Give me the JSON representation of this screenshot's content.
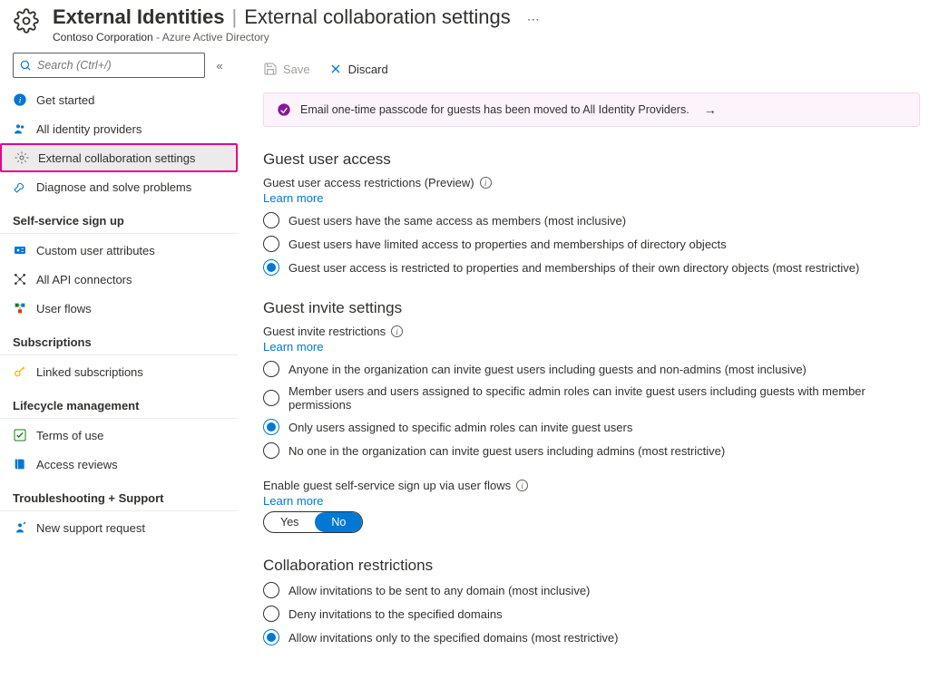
{
  "header": {
    "title_main": "External Identities",
    "title_sub": "External collaboration settings",
    "org": "Contoso Corporation",
    "service": "Azure Active Directory"
  },
  "sidebar": {
    "search_placeholder": "Search (Ctrl+/)",
    "items_top": [
      {
        "icon": "info",
        "label": "Get started"
      },
      {
        "icon": "people",
        "label": "All identity providers"
      },
      {
        "icon": "gear",
        "label": "External collaboration settings",
        "active": true
      },
      {
        "icon": "wrench",
        "label": "Diagnose and solve problems"
      }
    ],
    "sections": [
      {
        "title": "Self-service sign up",
        "items": [
          {
            "icon": "id",
            "label": "Custom user attributes"
          },
          {
            "icon": "api",
            "label": "All API connectors"
          },
          {
            "icon": "flow",
            "label": "User flows"
          }
        ]
      },
      {
        "title": "Subscriptions",
        "items": [
          {
            "icon": "key",
            "label": "Linked subscriptions"
          }
        ]
      },
      {
        "title": "Lifecycle management",
        "items": [
          {
            "icon": "check",
            "label": "Terms of use"
          },
          {
            "icon": "book",
            "label": "Access reviews"
          }
        ]
      },
      {
        "title": "Troubleshooting + Support",
        "items": [
          {
            "icon": "support",
            "label": "New support request"
          }
        ]
      }
    ]
  },
  "toolbar": {
    "save": "Save",
    "discard": "Discard"
  },
  "banner": "Email one-time passcode for guests has been moved to All Identity Providers.",
  "guest_access": {
    "heading": "Guest user access",
    "field": "Guest user access restrictions (Preview)",
    "learn": "Learn more",
    "options": [
      "Guest users have the same access as members (most inclusive)",
      "Guest users have limited access to properties and memberships of directory objects",
      "Guest user access is restricted to properties and memberships of their own directory objects (most restrictive)"
    ],
    "selected": 2
  },
  "guest_invite": {
    "heading": "Guest invite settings",
    "field": "Guest invite restrictions",
    "learn": "Learn more",
    "options": [
      "Anyone in the organization can invite guest users including guests and non-admins (most inclusive)",
      "Member users and users assigned to specific admin roles can invite guest users including guests with member permissions",
      "Only users assigned to specific admin roles can invite guest users",
      "No one in the organization can invite guest users including admins (most restrictive)"
    ],
    "selected": 2,
    "self_service_label": "Enable guest self-service sign up via user flows",
    "self_service_learn": "Learn more",
    "toggle_yes": "Yes",
    "toggle_no": "No"
  },
  "collab": {
    "heading": "Collaboration restrictions",
    "options": [
      "Allow invitations to be sent to any domain (most inclusive)",
      "Deny invitations to the specified domains",
      "Allow invitations only to the specified domains (most restrictive)"
    ],
    "selected": 2
  }
}
